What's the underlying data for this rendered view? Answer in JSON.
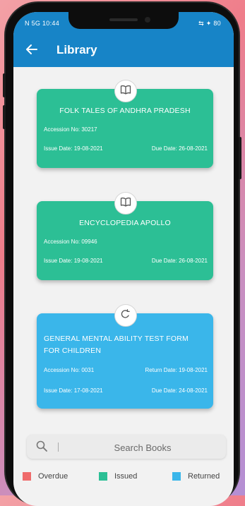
{
  "status_bar": {
    "left": "N 5G 10:44",
    "right": "⇆ ✦ 80"
  },
  "app_bar": {
    "title": "Library"
  },
  "books": [
    {
      "status": "issued",
      "title": "FOLK TALES OF ANDHRA PRADESH",
      "accession": "Accession No: 30217",
      "issue_date": "Issue Date: 19-08-2021",
      "due_date": "Due Date: 26-08-2021"
    },
    {
      "status": "issued",
      "title": "ENCYCLOPEDIA APOLLO",
      "accession": "Accession No: 09946",
      "issue_date": "Issue Date: 19-08-2021",
      "due_date": "Due Date: 26-08-2021"
    },
    {
      "status": "returned",
      "title": "GENERAL MENTAL ABILITY TEST FORM FOR CHILDREN",
      "accession": "Accession No: 0031",
      "return_date": "Return Date: 19-08-2021",
      "issue_date": "Issue Date: 17-08-2021",
      "due_date": "Due Date: 24-08-2021"
    }
  ],
  "search": {
    "placeholder": "Search Books"
  },
  "legend": [
    {
      "label": "Overdue",
      "color": "#ef6b6b"
    },
    {
      "label": "Issued",
      "color": "#2cbf95"
    },
    {
      "label": "Returned",
      "color": "#3ab6ea"
    }
  ],
  "colors": {
    "app_bar": "#1784c7",
    "issued_card": "#2cbf95",
    "returned_card": "#3ab6ea"
  }
}
